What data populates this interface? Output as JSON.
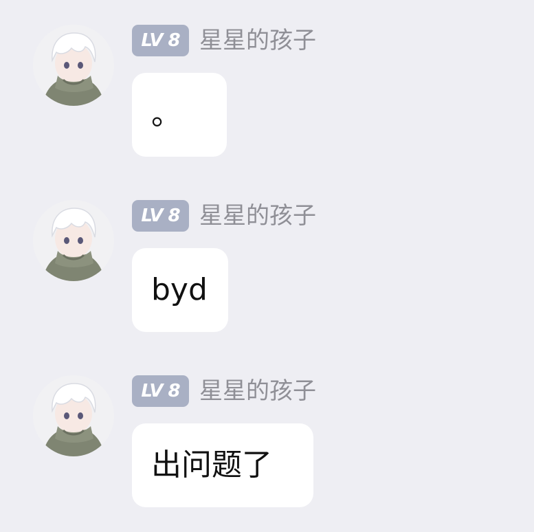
{
  "messages": [
    {
      "avatar_icon": "anime-avatar-icon",
      "level_badge": "LV 8",
      "sender_name": "星星的孩子",
      "text": "。"
    },
    {
      "avatar_icon": "anime-avatar-icon",
      "level_badge": "LV 8",
      "sender_name": "星星的孩子",
      "text": "byd"
    },
    {
      "avatar_icon": "anime-avatar-icon",
      "level_badge": "LV 8",
      "sender_name": "星星的孩子",
      "text": "出问题了"
    }
  ],
  "colors": {
    "background": "#eeeef3",
    "bubble": "#ffffff",
    "badge": "#a9b0c4",
    "name_text": "#8f8f96",
    "message_text": "#111111"
  }
}
